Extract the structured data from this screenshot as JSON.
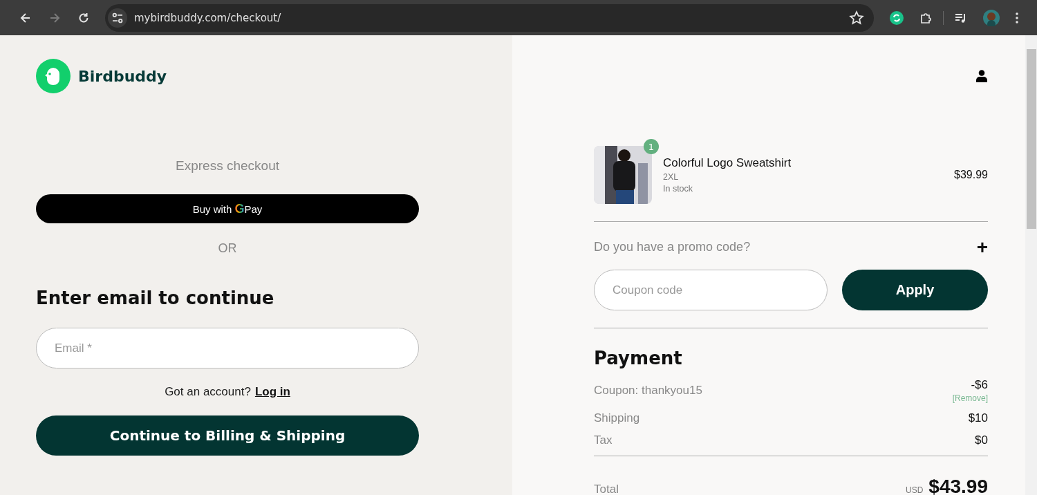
{
  "browser": {
    "url": "mybirdbuddy.com/checkout/"
  },
  "brand": {
    "name": "Birdbuddy"
  },
  "express": {
    "title": "Express checkout",
    "pay_button": {
      "prefix": "Buy with",
      "mark": "G",
      "suffix": "Pay"
    },
    "separator": "OR"
  },
  "email_form": {
    "heading": "Enter email to continue",
    "email": {
      "placeholder": "Email *"
    },
    "account_prompt": "Got an account?",
    "login_link": "Log in",
    "continue_button": "Continue to Billing & Shipping"
  },
  "cart": {
    "items": [
      {
        "name": "Colorful Logo Sweatshirt",
        "variant": "2XL",
        "stock": "In stock",
        "quantity": "1",
        "price": "$39.99"
      }
    ]
  },
  "promo": {
    "question": "Do you have a promo code?",
    "toggle": "+",
    "coupon": {
      "placeholder": "Coupon code"
    },
    "apply_button": "Apply"
  },
  "payment": {
    "heading": "Payment",
    "lines": [
      {
        "kind": "coupon",
        "label": "Coupon: thankyou15",
        "amount": "-$6",
        "action": "[Remove]"
      },
      {
        "kind": "plain",
        "label": "Shipping",
        "amount": "$10"
      },
      {
        "kind": "plain",
        "label": "Tax",
        "amount": "$0"
      }
    ],
    "total": {
      "label": "Total",
      "currency": "USD",
      "amount": "$43.99"
    }
  }
}
